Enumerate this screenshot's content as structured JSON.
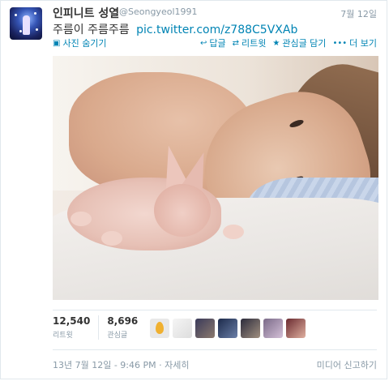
{
  "tweet": {
    "name": "인피니트 성열",
    "handle": "@Seongyeol1991",
    "date": "7월 12일",
    "text": "주름이 주름주름",
    "link": "pic.twitter.com/z788C5VXAb"
  },
  "actions": {
    "hide_photo": "사진 숨기기",
    "reply": "답글",
    "retweet": "리트윗",
    "favorite": "관심글 담기",
    "more": "더 보기",
    "icons": {
      "photo": "photo-icon",
      "reply": "reply-icon",
      "retweet": "retweet-icon",
      "favorite": "star-icon",
      "more": "more-dots-icon"
    }
  },
  "stats": {
    "retweets_count": "12,540",
    "retweets_label": "리트윗",
    "favorites_count": "8,696",
    "favorites_label": "관심글"
  },
  "footer": {
    "timestamp": "13년 7월 12일 - 9:46 PM",
    "separator": "·",
    "details": "자세히",
    "report": "미디어 신고하기"
  },
  "colors": {
    "link": "#0084b4",
    "muted": "#8899a6",
    "text": "#333333"
  }
}
